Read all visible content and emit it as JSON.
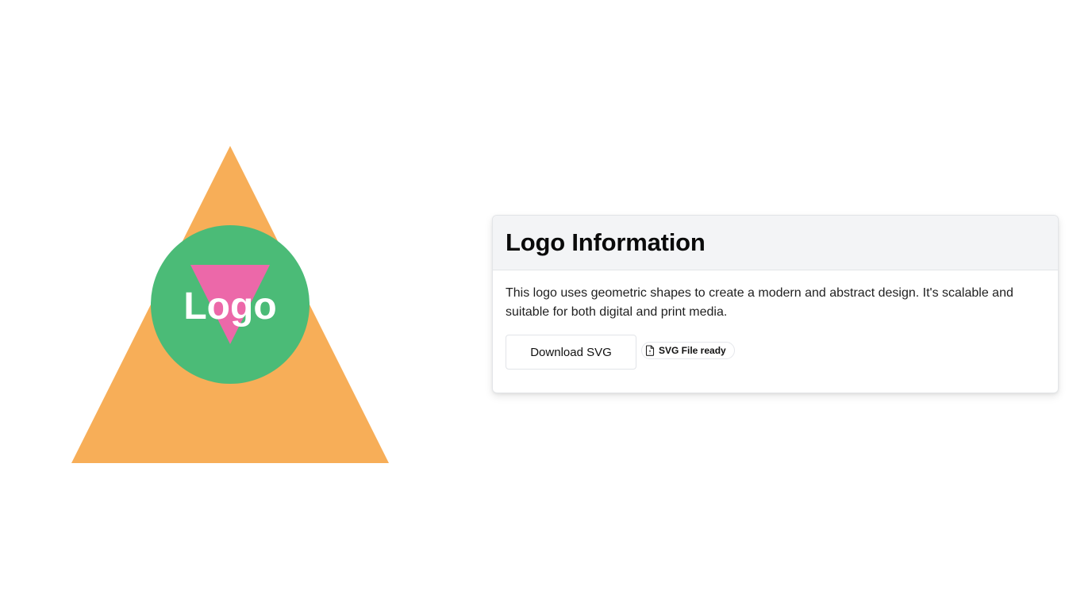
{
  "logo": {
    "text": "Logo",
    "colors": {
      "triangle": "#f7ae58",
      "circle": "#4bbb77",
      "inner_triangle": "#ec68a9",
      "text": "#ffffff"
    }
  },
  "card": {
    "title": "Logo Information",
    "description": "This logo uses geometric shapes to create a modern and abstract design. It's scalable and suitable for both digital and print media.",
    "download_label": "Download SVG",
    "badge": {
      "icon": "file-icon",
      "label": "SVG File ready"
    }
  }
}
